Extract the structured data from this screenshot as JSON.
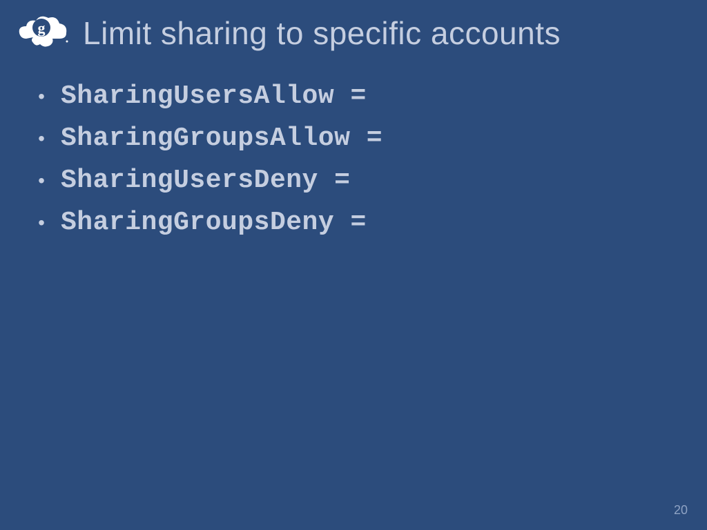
{
  "slide": {
    "title": "Limit sharing to specific accounts",
    "bullets": [
      "SharingUsersAllow =",
      "SharingGroupsAllow =",
      "SharingUsersDeny =",
      "SharingGroupsDeny ="
    ],
    "pageNumber": "20"
  }
}
